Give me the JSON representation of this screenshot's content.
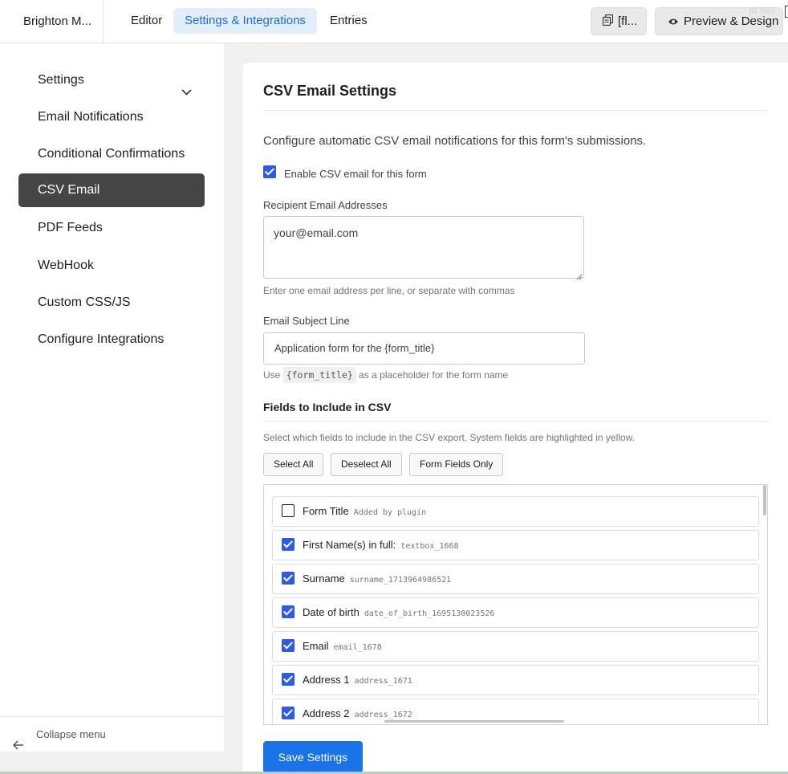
{
  "topbar": {
    "brand": "Brighton M...",
    "tabs": [
      {
        "label": "Editor",
        "active": false
      },
      {
        "label": "Settings & Integrations",
        "active": true
      },
      {
        "label": "Entries",
        "active": false
      }
    ],
    "shortcode_label": "[fl...",
    "shortcode_icon": "copy-icon",
    "preview_label": "Preview & Design",
    "preview_icon": "eye-icon",
    "corner_text": "Al Nel"
  },
  "sidebar": {
    "items": [
      {
        "label": "Settings",
        "active": false
      },
      {
        "label": "Email Notifications",
        "active": false
      },
      {
        "label": "Conditional Confirmations",
        "active": false
      },
      {
        "label": "CSV Email",
        "active": true
      },
      {
        "label": "PDF Feeds",
        "active": false
      },
      {
        "label": "WebHook",
        "active": false
      },
      {
        "label": "Custom CSS/JS",
        "active": false
      },
      {
        "label": "Configure Integrations",
        "active": false
      }
    ],
    "collapse_label": "Collapse menu"
  },
  "main": {
    "title": "CSV Email Settings",
    "description": "Configure automatic CSV email notifications for this form's submissions.",
    "enable_label": "Enable CSV email for this form",
    "enable_checked": true,
    "recipients_label": "Recipient Email Addresses",
    "recipients_value": "your@email.com",
    "recipients_help": "Enter one email address per line, or separate with commas",
    "subject_label": "Email Subject Line",
    "subject_value": "Application form for the {form_title}",
    "subject_help_prefix": "Use",
    "subject_help_code": "{form_title}",
    "subject_help_suffix": "as a placeholder for the form name",
    "fields_title": "Fields to Include in CSV",
    "fields_help": "Select which fields to include in the CSV export. System fields are highlighted in yellow.",
    "select_all": "Select All",
    "deselect_all": "Deselect All",
    "form_fields_only": "Form Fields Only",
    "fields": [
      {
        "name": "Form Title",
        "id": "Added by plugin",
        "checked": false
      },
      {
        "name": "First Name(s) in full:",
        "id": "textbox_1668",
        "checked": true
      },
      {
        "name": "Surname",
        "id": "surname_1713964986521",
        "checked": true
      },
      {
        "name": "Date of birth",
        "id": "date_of_birth_1695130023526",
        "checked": true
      },
      {
        "name": "Email",
        "id": "email_1678",
        "checked": true
      },
      {
        "name": "Address 1",
        "id": "address_1671",
        "checked": true
      },
      {
        "name": "Address 2",
        "id": "address_1672",
        "checked": true
      }
    ],
    "save_label": "Save Settings"
  }
}
